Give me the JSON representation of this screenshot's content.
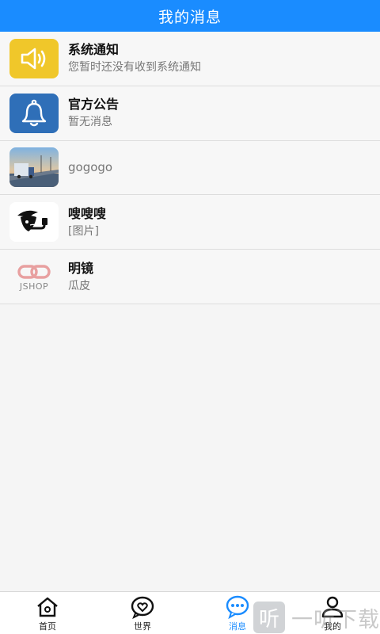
{
  "header": {
    "title": "我的消息"
  },
  "messages": [
    {
      "title": "系统通知",
      "subtitle": "您暂时还没有收到系统通知",
      "icon": "speaker-icon",
      "avatar_color": "#f0c72a"
    },
    {
      "title": "官方公告",
      "subtitle": "暂无消息",
      "icon": "bell-icon",
      "avatar_color": "#2f6fb8"
    },
    {
      "title": "gogogo",
      "avatar": "photo-bridge-truck"
    },
    {
      "title": "嗖嗖嗖",
      "subtitle": "[图片]",
      "avatar": "detective-pipe-logo"
    },
    {
      "title": "明镜",
      "subtitle": "瓜皮",
      "avatar": "jshop-logo",
      "logo_text": "JSHOP"
    }
  ],
  "tabs": [
    {
      "label": "首页",
      "icon": "home-icon"
    },
    {
      "label": "世界",
      "icon": "heart-chat-icon"
    },
    {
      "label": "消息",
      "icon": "message-bubble-icon",
      "active": true
    },
    {
      "label": "我的",
      "icon": "user-icon"
    }
  ],
  "watermark": {
    "logo_char": "听",
    "text": "一听下载"
  },
  "colors": {
    "accent": "#1a8cff",
    "header_bg": "#1a8cff"
  }
}
